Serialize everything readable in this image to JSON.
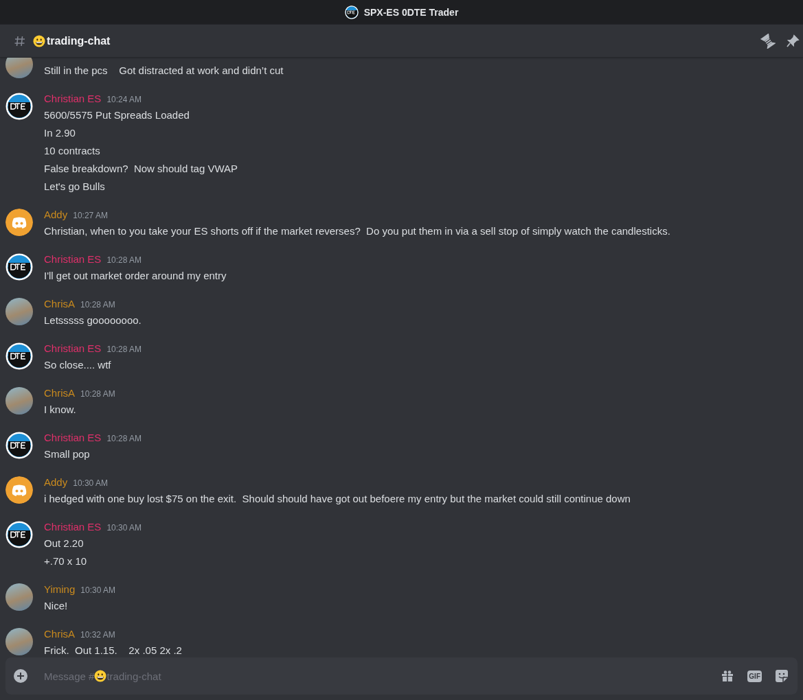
{
  "window": {
    "title": "SPX-ES 0DTE Trader"
  },
  "channel": {
    "name": "trading-chat"
  },
  "messages": [
    {
      "kind": "photo",
      "lines": [
        "Still in the pcs    Got distracted at work and didn’t cut"
      ]
    },
    {
      "kind": "logo",
      "author": "Christian ES",
      "color": "#e0306a",
      "time": "10:24 AM",
      "lines": [
        "5600/5575 Put Spreads Loaded",
        "In 2.90",
        "10 contracts",
        "False breakdown?  Now should tag VWAP",
        "Let's go Bulls"
      ]
    },
    {
      "kind": "discord",
      "author": "Addy",
      "color": "#c98a1e",
      "time": "10:27 AM",
      "lines": [
        "Christian, when to you take your ES shorts off if the market reverses?  Do you put them in via a sell stop of simply watch the candlesticks."
      ]
    },
    {
      "kind": "logo",
      "author": "Christian ES",
      "color": "#e0306a",
      "time": "10:28 AM",
      "lines": [
        "I'll get out market order around my entry"
      ]
    },
    {
      "kind": "photo",
      "author": "ChrisA",
      "color": "#c98a1e",
      "time": "10:28 AM",
      "lines": [
        "Letsssss goooooooo."
      ]
    },
    {
      "kind": "logo",
      "author": "Christian ES",
      "color": "#e0306a",
      "time": "10:28 AM",
      "lines": [
        "So close.... wtf"
      ]
    },
    {
      "kind": "photo",
      "author": "ChrisA",
      "color": "#c98a1e",
      "time": "10:28 AM",
      "lines": [
        "I know."
      ]
    },
    {
      "kind": "logo",
      "author": "Christian ES",
      "color": "#e0306a",
      "time": "10:28 AM",
      "lines": [
        "Small pop"
      ]
    },
    {
      "kind": "discord",
      "author": "Addy",
      "color": "#c98a1e",
      "time": "10:30 AM",
      "lines": [
        "i hedged with one buy lost $75 on the exit.  Should should have got out befoere my entry but the market could still continue down"
      ]
    },
    {
      "kind": "logo",
      "author": "Christian ES",
      "color": "#e0306a",
      "time": "10:30 AM",
      "lines": [
        "Out 2.20",
        "+.70 x 10"
      ]
    },
    {
      "kind": "photo",
      "author": "Yiming",
      "color": "#c98a1e",
      "time": "10:30 AM",
      "lines": [
        "Nice!"
      ]
    },
    {
      "kind": "photo",
      "author": "ChrisA",
      "color": "#c98a1e",
      "time": "10:32 AM",
      "lines": [
        "Frick.  Out 1.15.    2x .05 2x .2"
      ]
    }
  ],
  "composer": {
    "hint_prefix": "Message #",
    "hint_channel": "trading-chat",
    "gif_label": "GIF"
  }
}
